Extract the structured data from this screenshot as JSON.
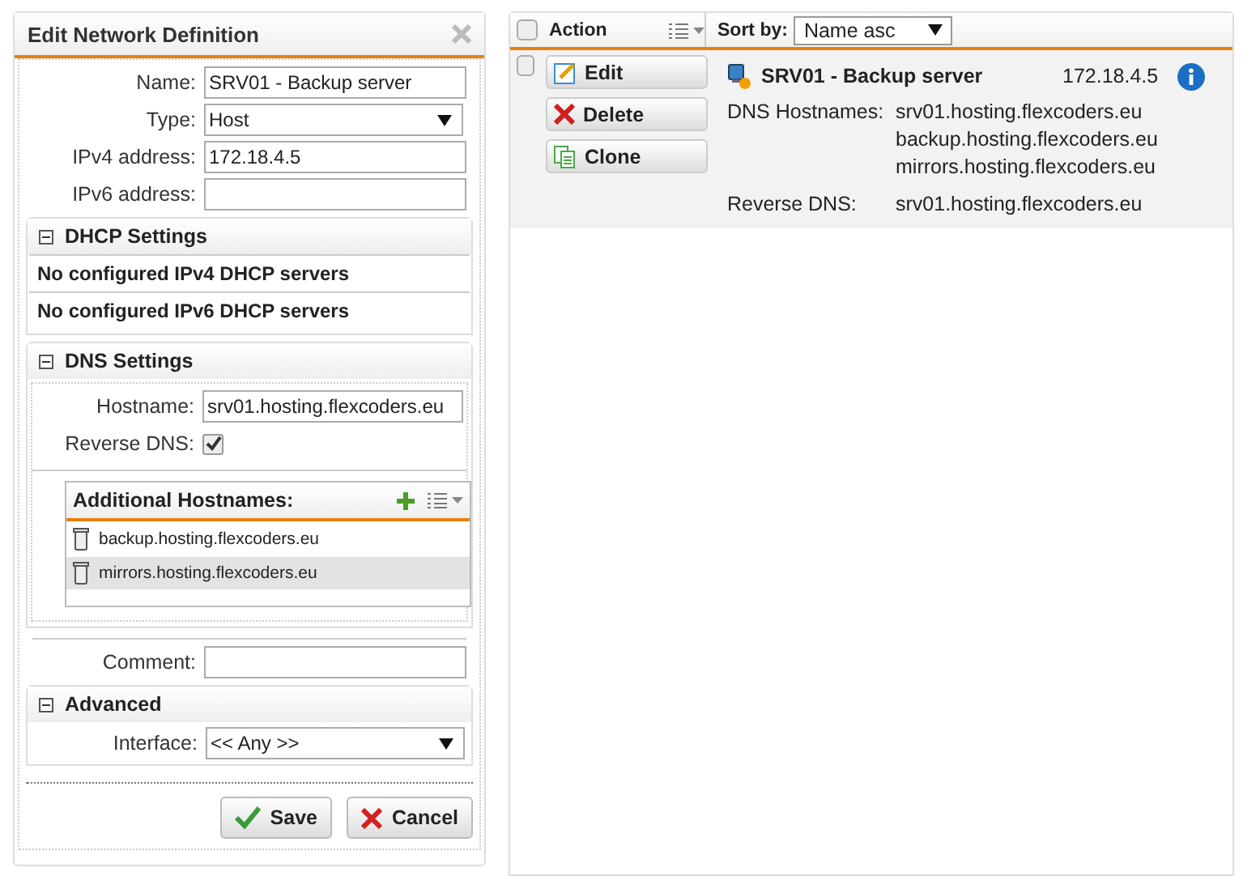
{
  "dialog": {
    "title": "Edit Network Definition",
    "fields": [
      {
        "label": "Name:",
        "kind": "text",
        "value": "SRV01 - Backup server"
      },
      {
        "label": "Type:",
        "kind": "select",
        "value": "Host"
      },
      {
        "label": "IPv4 address:",
        "kind": "text",
        "value": "172.18.4.5"
      },
      {
        "label": "IPv6 address:",
        "kind": "text"
      }
    ],
    "dhcp": {
      "title": "DHCP Settings",
      "expanded": true,
      "rows": [
        "No configured IPv4 DHCP servers",
        "No configured IPv6 DHCP servers"
      ]
    },
    "dns": {
      "title": "DNS Settings",
      "expanded": true,
      "hostname_label": "Hostname:",
      "hostname": "srv01.hosting.flexcoders.eu",
      "reverse_label": "Reverse DNS:",
      "reverse_checked": true,
      "additional": {
        "title": "Additional Hostnames:",
        "items": [
          {
            "text": "backup.hosting.flexcoders.eu",
            "selected": false
          },
          {
            "text": "mirrors.hosting.flexcoders.eu",
            "selected": true
          }
        ]
      }
    },
    "comment": {
      "label": "Comment:"
    },
    "advanced": {
      "title": "Advanced",
      "expanded": true,
      "interface_label": "Interface:",
      "interface": "<< Any >>"
    },
    "buttons": [
      {
        "label": "Save",
        "kind": "save"
      },
      {
        "label": "Cancel",
        "kind": "cancel"
      }
    ]
  },
  "list": {
    "header": {
      "checked": false,
      "action": "Action",
      "sort_label": "Sort by:",
      "sort": "Name asc"
    },
    "rows": [
      {
        "checked": false,
        "actions": [
          {
            "label": "Edit",
            "kind": "edit"
          },
          {
            "label": "Delete",
            "kind": "delete"
          },
          {
            "label": "Clone",
            "kind": "clone"
          }
        ],
        "name": "SRV01 - Backup server",
        "address": "172.18.4.5",
        "details": [
          {
            "label": "DNS Hostnames:",
            "values": [
              "srv01.hosting.flexcoders.eu",
              "backup.hosting.flexcoders.eu",
              "mirrors.hosting.flexcoders.eu"
            ]
          },
          {
            "label": "Reverse DNS:",
            "values": [
              "srv01.hosting.flexcoders.eu"
            ]
          }
        ]
      }
    ]
  }
}
